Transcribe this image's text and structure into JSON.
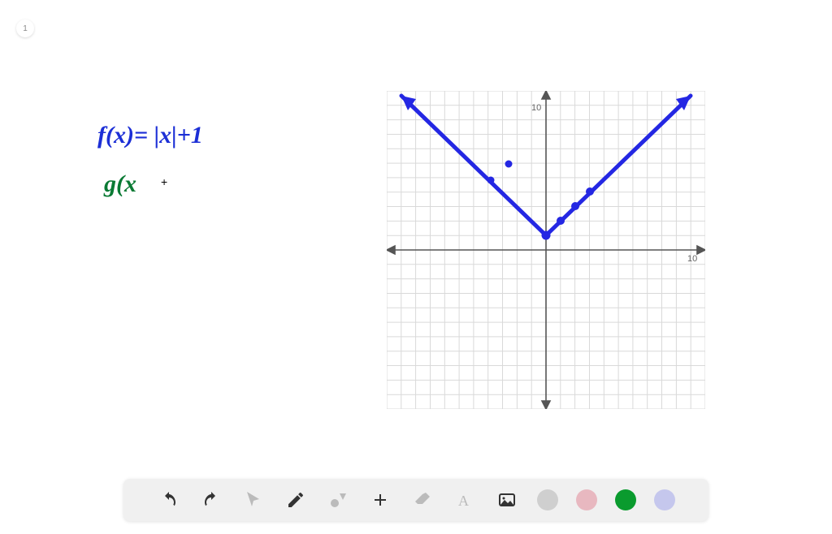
{
  "page_badge": "1",
  "equations": {
    "f": "f(x)= |x|+1",
    "g_partial": "g(x"
  },
  "cursor_glyph": "+",
  "chart_data": {
    "type": "line",
    "series": [
      {
        "name": "f(x)=|x|+1",
        "color": "#2427e3",
        "x": [
          -10,
          -8,
          -6,
          -4,
          -2,
          0,
          2,
          4,
          6,
          8,
          10
        ],
        "y": [
          11,
          9,
          7,
          5,
          3,
          1,
          3,
          5,
          7,
          9,
          11
        ]
      }
    ],
    "xlabel": "",
    "ylabel": "",
    "xlim": [
      -11,
      11
    ],
    "ylim": [
      -11,
      11
    ],
    "x_tick_labels": [
      "10"
    ],
    "y_tick_labels": [
      "10"
    ],
    "grid": true,
    "arrows_on_axes": true,
    "arrows_on_curve": true
  },
  "toolbar": {
    "undo": "Undo",
    "redo": "Redo",
    "pointer": "Pointer",
    "pencil": "Pencil",
    "shapes": "Shapes",
    "plus": "Add",
    "eraser": "Eraser",
    "text": "Text",
    "image": "Image",
    "color_gray": "Gray",
    "color_pink": "Pink",
    "color_green": "Green",
    "color_lilac": "Lilac"
  }
}
